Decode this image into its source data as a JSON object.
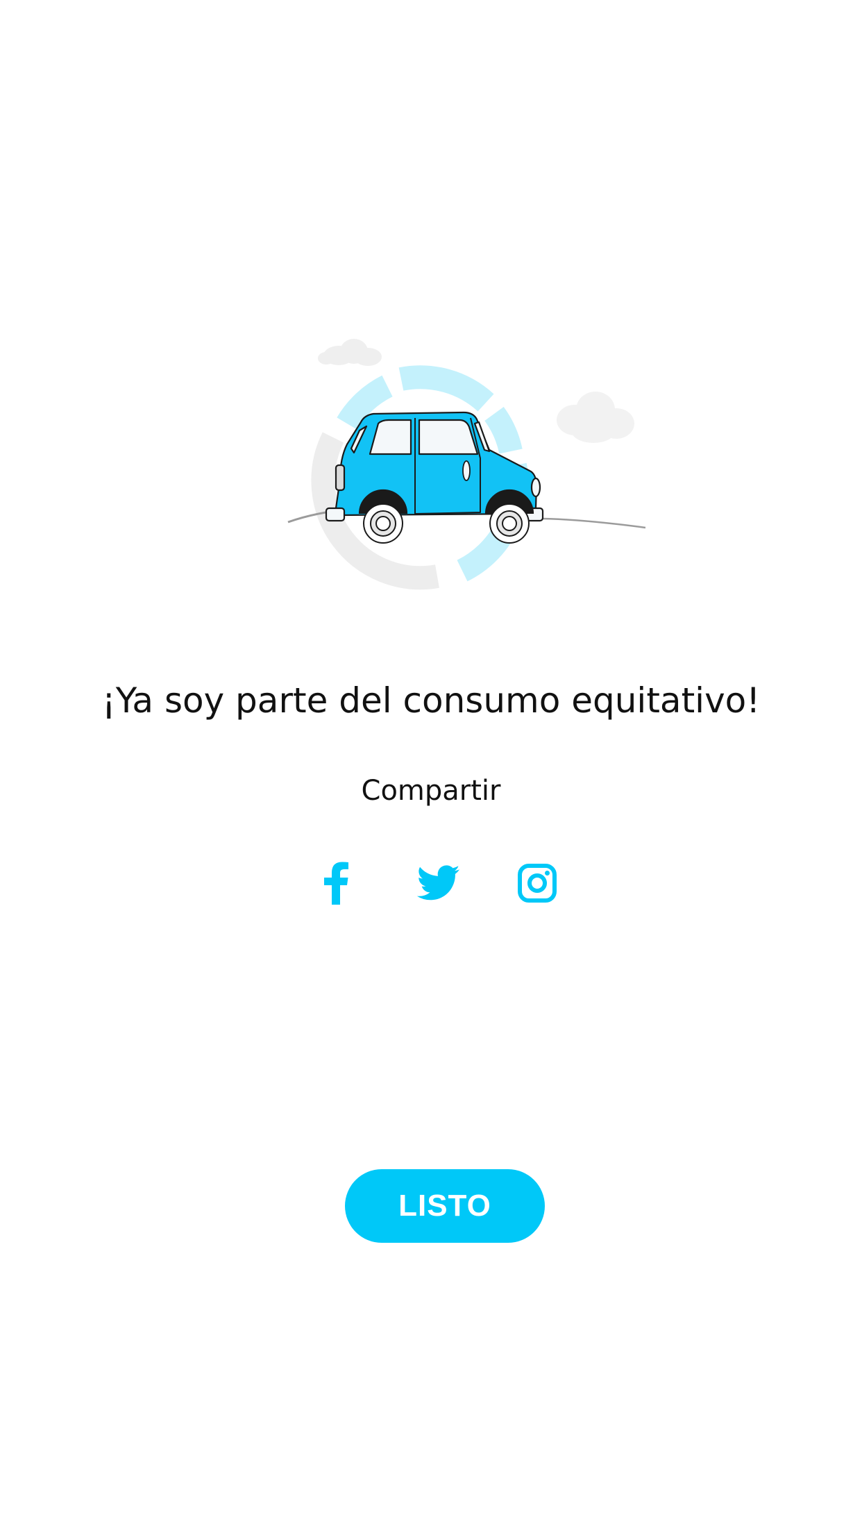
{
  "colors": {
    "accent": "#00C8F8",
    "text": "#111111",
    "background": "#FFFFFF",
    "ring_light": "#C4F1FC",
    "ring_gray": "#EDEDED"
  },
  "headline": "¡Ya soy parte del consumo equitativo!",
  "share": {
    "label": "Compartir",
    "networks": [
      {
        "name": "Facebook",
        "icon": "facebook-icon"
      },
      {
        "name": "Twitter",
        "icon": "twitter-icon"
      },
      {
        "name": "Instagram",
        "icon": "instagram-icon"
      }
    ]
  },
  "done_button": {
    "label": "LISTO"
  }
}
